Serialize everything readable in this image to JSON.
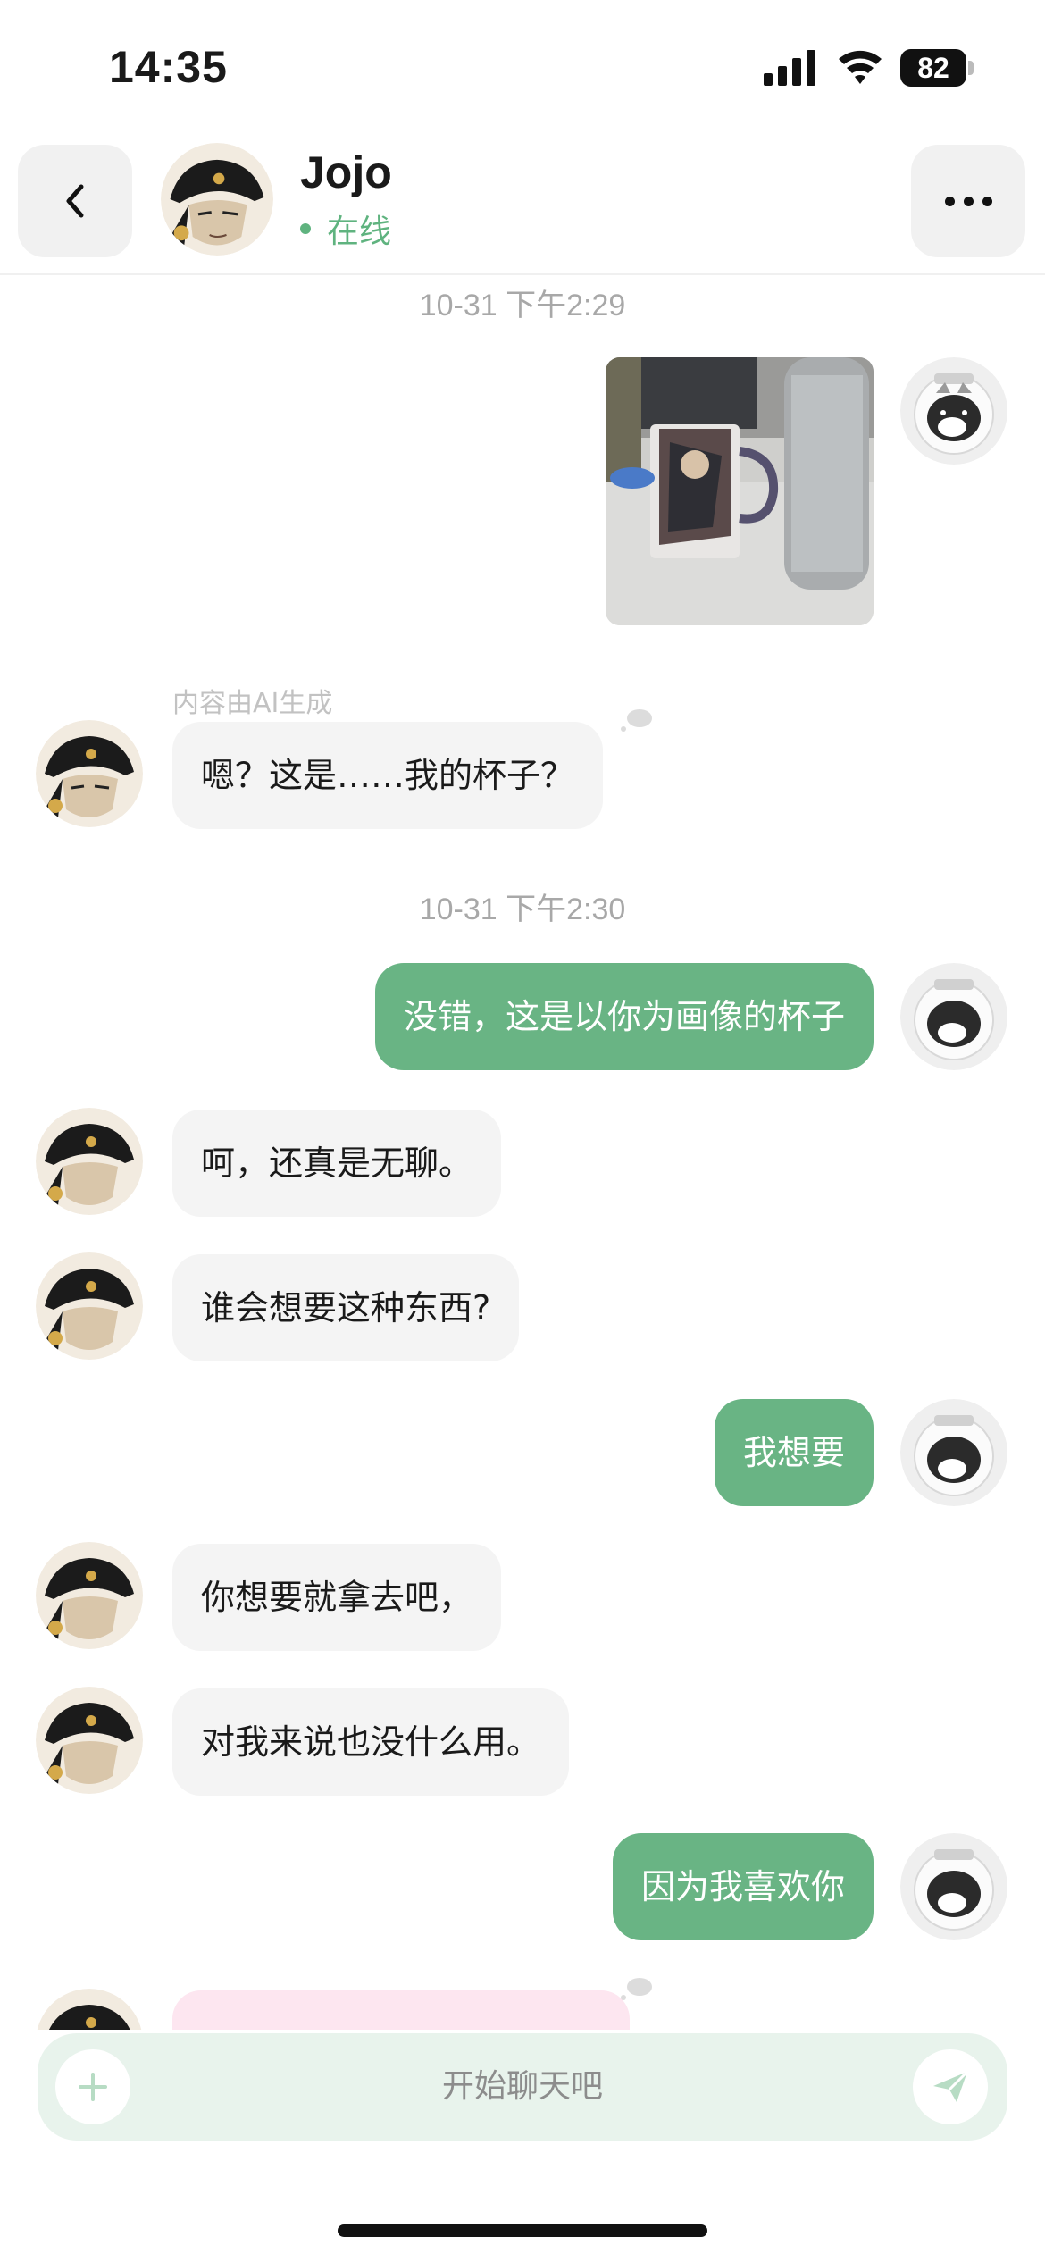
{
  "status_bar": {
    "time": "14:35",
    "battery": "82",
    "icons": [
      "signal-icon",
      "wifi-icon",
      "battery-icon"
    ]
  },
  "header": {
    "back_icon": "chevron-left-icon",
    "contact_name": "Jojo",
    "status": "在线",
    "more_icon": "more-dots-icon"
  },
  "chat": {
    "timestamps": [
      "10-31 下午2:29",
      "10-31 下午2:30"
    ],
    "ai_label": "内容由AI生成",
    "messages": [
      {
        "from": "user",
        "type": "image",
        "text": ""
      },
      {
        "from": "jojo",
        "type": "text",
        "text": "嗯？这是……我的杯子？"
      },
      {
        "from": "user",
        "type": "text",
        "text": "没错，这是以你为画像的杯子"
      },
      {
        "from": "jojo",
        "type": "text",
        "text": "呵，还真是无聊。"
      },
      {
        "from": "jojo",
        "type": "text",
        "text": "谁会想要这种东西?"
      },
      {
        "from": "user",
        "type": "text",
        "text": "我想要"
      },
      {
        "from": "jojo",
        "type": "text",
        "text": "你想要就拿去吧，"
      },
      {
        "from": "jojo",
        "type": "text",
        "text": "对我来说也没什么用。"
      },
      {
        "from": "user",
        "type": "text",
        "text": "因为我喜欢你"
      },
      {
        "from": "jojo",
        "type": "text",
        "text": ""
      }
    ]
  },
  "input": {
    "placeholder": "开始聊天吧",
    "add_icon": "plus-icon",
    "send_icon": "send-paper-plane-icon"
  },
  "colors": {
    "outgoing_bubble": "#69b484",
    "incoming_bubble": "#f4f4f4",
    "online": "#5fb37f",
    "input_bar": "#e8f3ec"
  }
}
